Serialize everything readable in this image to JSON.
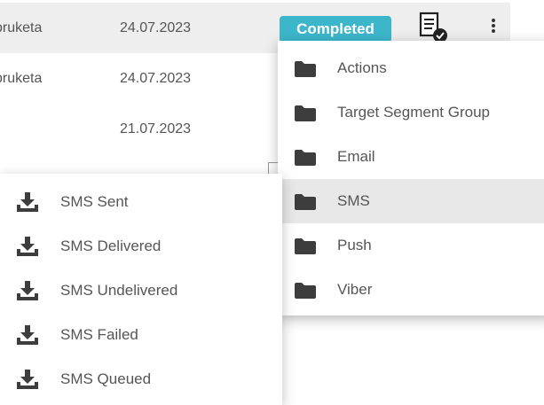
{
  "table": {
    "rows": [
      {
        "name": "pruketa",
        "date": "24.07.2023",
        "status": "Completed"
      },
      {
        "name": "pruketa",
        "date": "24.07.2023"
      },
      {
        "name": "",
        "date": "21.07.2023"
      }
    ]
  },
  "export_menu": {
    "items": [
      {
        "label": "Actions",
        "icon": "folder-icon"
      },
      {
        "label": "Target Segment Group",
        "icon": "folder-icon"
      },
      {
        "label": "Email",
        "icon": "folder-icon"
      },
      {
        "label": "SMS",
        "icon": "folder-icon",
        "active": true
      },
      {
        "label": "Push",
        "icon": "folder-icon"
      },
      {
        "label": "Viber",
        "icon": "folder-icon"
      }
    ]
  },
  "sms_submenu": {
    "items": [
      {
        "label": "SMS Sent",
        "icon": "download-icon"
      },
      {
        "label": "SMS Delivered",
        "icon": "download-icon"
      },
      {
        "label": "SMS Undelivered",
        "icon": "download-icon"
      },
      {
        "label": "SMS Failed",
        "icon": "download-icon"
      },
      {
        "label": "SMS Queued",
        "icon": "download-icon"
      }
    ]
  },
  "colors": {
    "status_badge": "#3cb6cb",
    "row_highlight": "#eeeeee",
    "menu_active": "#e8e8e8",
    "icon": "#3d3d3d"
  }
}
